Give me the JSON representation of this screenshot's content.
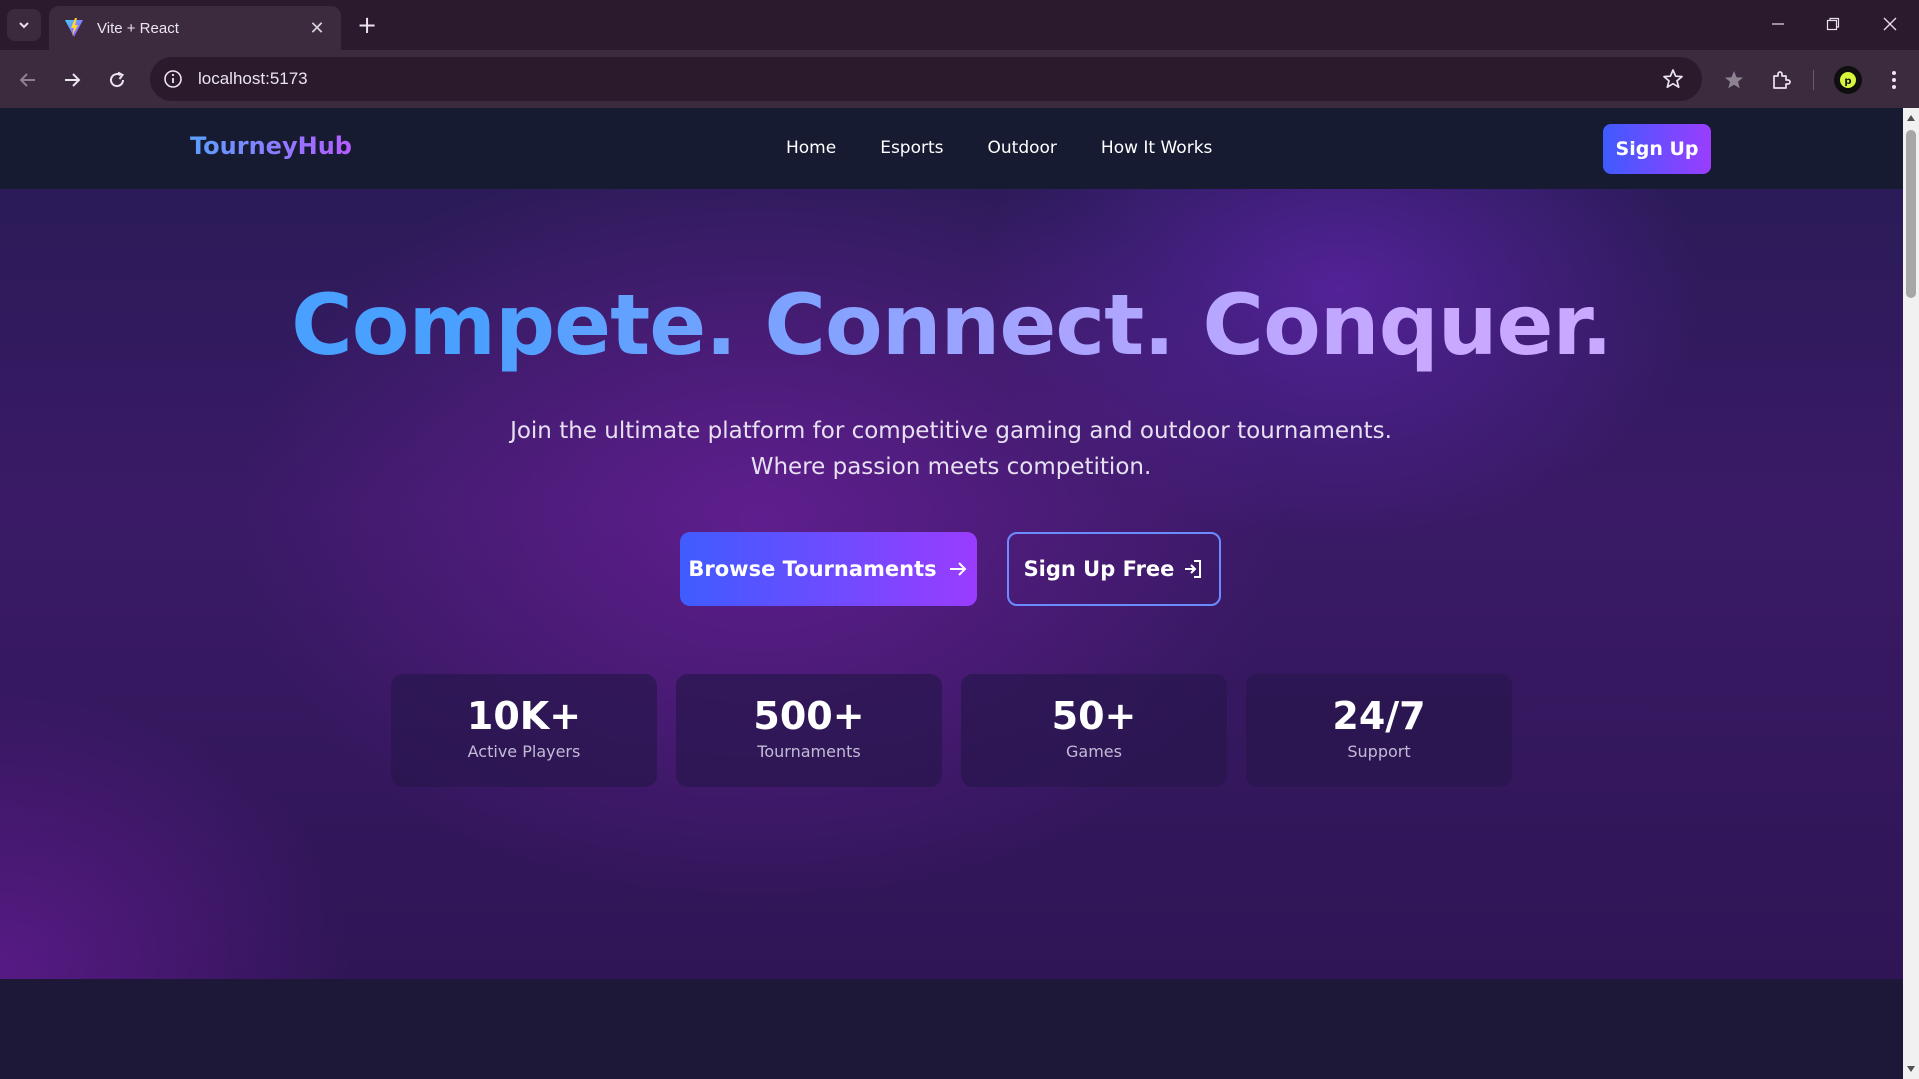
{
  "browser": {
    "tab": {
      "title": "Vite + React",
      "favicon": "vite-logo-icon",
      "close": "✕"
    },
    "new_tab": "+",
    "address": {
      "url": "localhost:5173"
    },
    "icons": [
      "back-icon",
      "forward-icon",
      "reload-icon",
      "site-info-icon",
      "bookmark-star-icon",
      "extension-star-icon",
      "extensions-puzzle-icon",
      "profile-avatar-icon",
      "menu-kebab-icon",
      "minimize-icon",
      "restore-icon",
      "close-window-icon"
    ]
  },
  "site": {
    "logo": "TourneyHub",
    "nav": {
      "links": [
        "Home",
        "Esports",
        "Outdoor",
        "How It Works"
      ],
      "signup": "Sign Up"
    },
    "hero": {
      "title": "Compete. Connect. Conquer.",
      "subtitle": "Join the ultimate platform for competitive gaming and outdoor tournaments. Where passion meets competition.",
      "primary_cta": "Browse Tournaments",
      "secondary_cta": "Sign Up Free"
    },
    "stats": [
      {
        "value": "10K+",
        "label": "Active Players"
      },
      {
        "value": "500+",
        "label": "Tournaments"
      },
      {
        "value": "50+",
        "label": "Games"
      },
      {
        "value": "24/7",
        "label": "Support"
      }
    ]
  },
  "colors": {
    "accent_blue": "#3f5cff",
    "accent_purple": "#9a3cff",
    "nav_bg": "#171b32",
    "hero_bg": "#3a1a66"
  }
}
